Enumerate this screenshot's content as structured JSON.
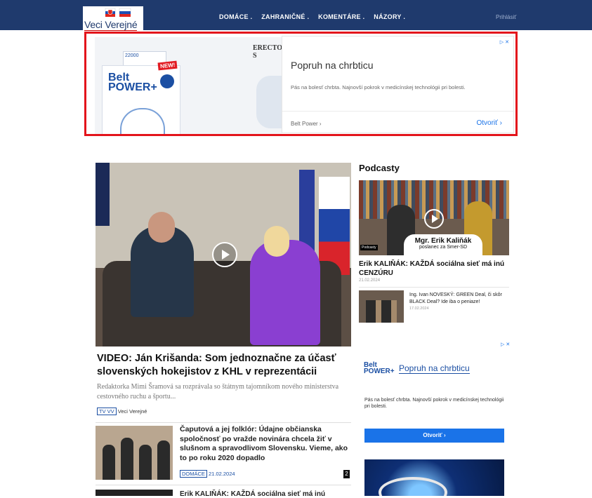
{
  "header": {
    "logo_text": "Veci Verejné",
    "nav": [
      "DOMÁCE .",
      "ZAHRANIČNÉ .",
      "KOMENTÁRE .",
      "NÁZORY ."
    ],
    "login": "Prihlásiť"
  },
  "ad_top": {
    "image_heading": "ERECTOR S",
    "product_lines": [
      "Belt",
      "POWER+"
    ],
    "new_badge": "NEW!",
    "title": "Popruh na chrbticu",
    "description": "Pás na bolesť chrbta. Najnovší pokrok v medicínskej technológii pri bolesti.",
    "source": "Belt Power ›",
    "cta": "Otvoriť ›",
    "adchoices": "▷ ✕"
  },
  "main": {
    "headline": "VIDEO: Ján Krišanda: Som jednoznačne za účasť slovenských hokejistov z KHL v reprezentácii",
    "lead": "Redaktorka Mimi Šramová sa rozprávala so štátnym tajomníkom nového ministerstva cestovného ruchu a športu...",
    "tag": "TV VV",
    "author": "Veci Verejné",
    "articles": [
      {
        "title": "Čaputová a jej folklór: Údajne občianska spoločnosť po vražde novinára chcela žiť v slušnom a spravodlivom Slovensku. Vieme, ako to po roku 2020 dopadlo",
        "tag": "DOMÁCE",
        "date": "21.02.2024",
        "comments": "2"
      },
      {
        "title": "Erik KALIŇÁK: KAŽDÁ sociálna sieť má inú"
      }
    ]
  },
  "sidebar": {
    "heading": "Podcasty",
    "featured": {
      "caption_name": "Mgr. Erik Kaliňák",
      "caption_role": "poslanec za Smer-SD",
      "badge": "Podcasty",
      "title": "Erik KALIŇÁK: KAŽDÁ sociálna sieť má inú CENZÚRU",
      "date": "21.02.2024"
    },
    "second": {
      "title": "Ing. Ivan NOVESKÝ: GREEN Deal, či skôr BLACK Deal? Ide iba o peniaze!",
      "date": "17.02.2024"
    }
  },
  "ad_side": {
    "adchoices": "▷ ✕",
    "logo_lines": [
      "Belt",
      "POWER+"
    ],
    "title": "Popruh na chrbticu",
    "description": "Pás na bolesť chrbta. Najnovší pokrok v medicínskej technológii pri bolesti.",
    "cta": "Otvoriť ›"
  },
  "colors": {
    "header_bg": "#1f3a6d",
    "ad_highlight": "#e3141b",
    "link_blue": "#1a73e8"
  }
}
